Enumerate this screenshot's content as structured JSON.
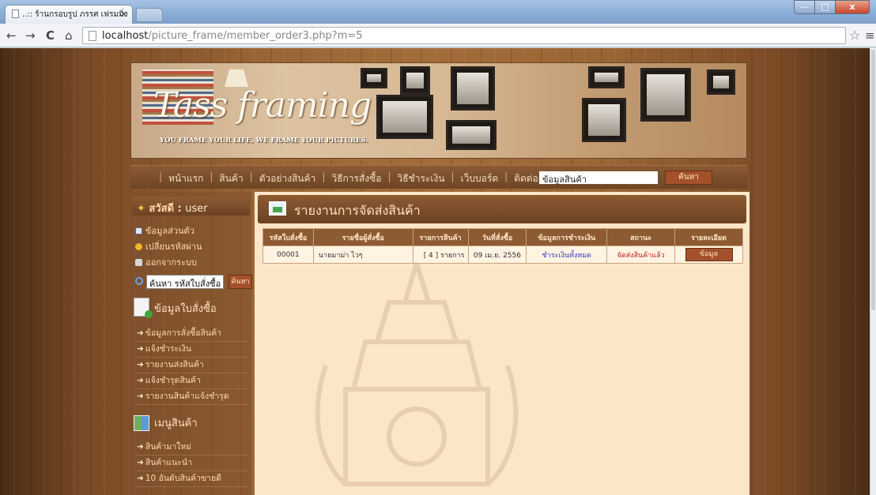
{
  "browser": {
    "tab_title": "..:: ร้านกรอบรูป ภรรศ เฟรมมิ่ง",
    "tab_close": "×",
    "url_host": "localhost",
    "url_path": "/picture_frame/member_order3.php?m=5",
    "nav_back": "←",
    "nav_forward": "→",
    "nav_reload": "C",
    "nav_home": "⌂",
    "star": "☆",
    "menu": "≡",
    "win_min": "—",
    "win_max": "□",
    "win_close": "x"
  },
  "banner": {
    "brand": "Tass framing",
    "tagline": "YOU FRAME YOUR LIFE, WE FRAME YOUR PICTURES."
  },
  "topnav": {
    "items": [
      "หน้าแรก",
      "สินค้า",
      "ตัวอย่างสินค้า",
      "วิธีการสั่งซื้อ",
      "วิธีชำระเงิน",
      "เว็บบอร์ด",
      "ติดต่อเรา"
    ],
    "search_value": "ข้อมูลสินค้า",
    "search_button": "ค้นหา"
  },
  "sidebar": {
    "greeting_label": "สวัสดี :",
    "username": "user",
    "account_links": [
      "ข้อมูลส่วนตัว",
      "เปลี่ยนรหัสผ่าน",
      "ออกจากระบบ"
    ],
    "order_search_value": "ค้นหา รหัสใบสั่งซื้อ",
    "order_search_button": "ค้นหา",
    "order_section_title": "ข้อมูลใบสั่งซื้อ",
    "order_links": [
      "ข้อมูลการสั่งซื้อสินค้า",
      "แจ้งชำระเงิน",
      "รายงานส่งสินค้า",
      "แจ้งชำรุดสินค้า",
      "รายงานสินค้าแจ้งชำรุด"
    ],
    "product_section_title": "เมนูสินค้า",
    "product_links": [
      "สินค้ามาใหม่",
      "สินค้าแนะนำ",
      "10 อันดับสินค้าขายดี"
    ]
  },
  "report": {
    "title": "รายงานการจัดส่งสินค้า",
    "columns": [
      "รหัสใบสั่งซื้อ",
      "รายชื่อผู้สั่งซื้อ",
      "รายการสินค้า",
      "วันที่สั่งซื้อ",
      "ข้อมูลการชำระเงิน",
      "สถานะ",
      "รายละเอียด"
    ],
    "rows": [
      {
        "order_id": "00001",
        "customer": "นายมาม่า ไวๆ",
        "items": "[ 4 ] รายการ",
        "date": "09 เม.ย. 2556",
        "payment": "ชำระเงินทั้งหมด",
        "status": "จัดส่งสินค้าแล้ว",
        "detail_button": "ข้อมูล"
      }
    ]
  },
  "colors": {
    "accent_brown": "#8c5a33",
    "button_rust": "#a4512b",
    "content_bg": "#fbe6c8",
    "payment_text": "#3436c9",
    "status_text": "#b8211a"
  }
}
